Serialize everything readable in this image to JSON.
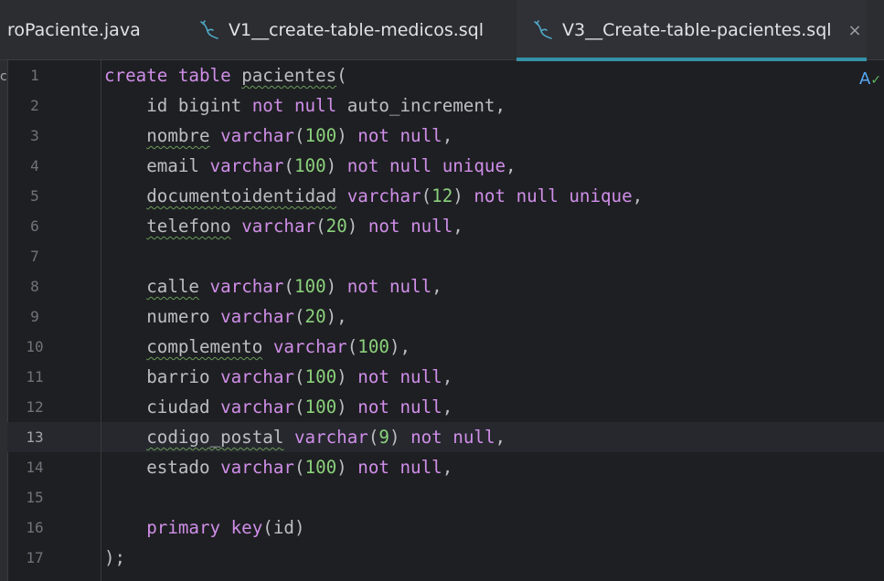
{
  "tabs": [
    {
      "label": "roPaciente.java",
      "icon": "none",
      "active": false
    },
    {
      "label": "V1__create-table-medicos.sql",
      "icon": "sql-dolphin-icon",
      "active": false
    },
    {
      "label": "V3__Create-table-pacientes.sql",
      "icon": "sql-dolphin-icon",
      "active": true,
      "close": "×"
    }
  ],
  "left_cut_text": "c",
  "inspection_widget": "A",
  "current_line": 13,
  "colors": {
    "background": "#1e1f22",
    "keyword": "#cf8ee8",
    "number": "#8bd17c",
    "plain": "#bcbec4",
    "active_tab_underline": "#3592a8"
  },
  "lines": [
    {
      "n": "1",
      "tokens": [
        {
          "t": "kw",
          "v": "create"
        },
        {
          "t": "pl",
          "v": " "
        },
        {
          "t": "kw",
          "v": "table"
        },
        {
          "t": "pl",
          "v": " "
        },
        {
          "t": "sq",
          "v": "pacientes"
        },
        {
          "t": "pl",
          "v": "("
        }
      ]
    },
    {
      "n": "2",
      "tokens": [
        {
          "t": "pl",
          "v": "    id "
        },
        {
          "t": "pl",
          "v": "bigint"
        },
        {
          "t": "pl",
          "v": " "
        },
        {
          "t": "kw",
          "v": "not null"
        },
        {
          "t": "pl",
          "v": " auto_increment,"
        }
      ]
    },
    {
      "n": "3",
      "tokens": [
        {
          "t": "pl",
          "v": "    "
        },
        {
          "t": "sq",
          "v": "nombre"
        },
        {
          "t": "pl",
          "v": " "
        },
        {
          "t": "ty",
          "v": "varchar"
        },
        {
          "t": "pl",
          "v": "("
        },
        {
          "t": "num",
          "v": "100"
        },
        {
          "t": "pl",
          "v": ") "
        },
        {
          "t": "kw",
          "v": "not null"
        },
        {
          "t": "pl",
          "v": ","
        }
      ]
    },
    {
      "n": "4",
      "tokens": [
        {
          "t": "pl",
          "v": "    email "
        },
        {
          "t": "ty",
          "v": "varchar"
        },
        {
          "t": "pl",
          "v": "("
        },
        {
          "t": "num",
          "v": "100"
        },
        {
          "t": "pl",
          "v": ") "
        },
        {
          "t": "kw",
          "v": "not null unique"
        },
        {
          "t": "pl",
          "v": ","
        }
      ]
    },
    {
      "n": "5",
      "tokens": [
        {
          "t": "pl",
          "v": "    "
        },
        {
          "t": "sq",
          "v": "documentoidentidad"
        },
        {
          "t": "pl",
          "v": " "
        },
        {
          "t": "ty",
          "v": "varchar"
        },
        {
          "t": "pl",
          "v": "("
        },
        {
          "t": "num",
          "v": "12"
        },
        {
          "t": "pl",
          "v": ") "
        },
        {
          "t": "kw",
          "v": "not null unique"
        },
        {
          "t": "pl",
          "v": ","
        }
      ]
    },
    {
      "n": "6",
      "tokens": [
        {
          "t": "pl",
          "v": "    "
        },
        {
          "t": "sq",
          "v": "telefono"
        },
        {
          "t": "pl",
          "v": " "
        },
        {
          "t": "ty",
          "v": "varchar"
        },
        {
          "t": "pl",
          "v": "("
        },
        {
          "t": "num",
          "v": "20"
        },
        {
          "t": "pl",
          "v": ") "
        },
        {
          "t": "kw",
          "v": "not null"
        },
        {
          "t": "pl",
          "v": ","
        }
      ]
    },
    {
      "n": "7",
      "tokens": []
    },
    {
      "n": "8",
      "tokens": [
        {
          "t": "pl",
          "v": "    "
        },
        {
          "t": "sq",
          "v": "calle"
        },
        {
          "t": "pl",
          "v": " "
        },
        {
          "t": "ty",
          "v": "varchar"
        },
        {
          "t": "pl",
          "v": "("
        },
        {
          "t": "num",
          "v": "100"
        },
        {
          "t": "pl",
          "v": ") "
        },
        {
          "t": "kw",
          "v": "not null"
        },
        {
          "t": "pl",
          "v": ","
        }
      ]
    },
    {
      "n": "9",
      "tokens": [
        {
          "t": "pl",
          "v": "    numero "
        },
        {
          "t": "ty",
          "v": "varchar"
        },
        {
          "t": "pl",
          "v": "("
        },
        {
          "t": "num",
          "v": "20"
        },
        {
          "t": "pl",
          "v": "),"
        }
      ]
    },
    {
      "n": "10",
      "tokens": [
        {
          "t": "pl",
          "v": "    "
        },
        {
          "t": "sq",
          "v": "complemento"
        },
        {
          "t": "pl",
          "v": " "
        },
        {
          "t": "ty",
          "v": "varchar"
        },
        {
          "t": "pl",
          "v": "("
        },
        {
          "t": "num",
          "v": "100"
        },
        {
          "t": "pl",
          "v": "),"
        }
      ]
    },
    {
      "n": "11",
      "tokens": [
        {
          "t": "pl",
          "v": "    barrio "
        },
        {
          "t": "ty",
          "v": "varchar"
        },
        {
          "t": "pl",
          "v": "("
        },
        {
          "t": "num",
          "v": "100"
        },
        {
          "t": "pl",
          "v": ") "
        },
        {
          "t": "kw",
          "v": "not null"
        },
        {
          "t": "pl",
          "v": ","
        }
      ]
    },
    {
      "n": "12",
      "tokens": [
        {
          "t": "pl",
          "v": "    ciudad "
        },
        {
          "t": "ty",
          "v": "varchar"
        },
        {
          "t": "pl",
          "v": "("
        },
        {
          "t": "num",
          "v": "100"
        },
        {
          "t": "pl",
          "v": ") "
        },
        {
          "t": "kw",
          "v": "not null"
        },
        {
          "t": "pl",
          "v": ","
        }
      ]
    },
    {
      "n": "13",
      "tokens": [
        {
          "t": "pl",
          "v": "    "
        },
        {
          "t": "sq",
          "v": "codigo_postal"
        },
        {
          "t": "pl",
          "v": " "
        },
        {
          "t": "ty",
          "v": "varchar"
        },
        {
          "t": "pl",
          "v": "("
        },
        {
          "t": "num",
          "v": "9"
        },
        {
          "t": "pl",
          "v": ") "
        },
        {
          "t": "kw",
          "v": "not null"
        },
        {
          "t": "pl",
          "v": ","
        }
      ]
    },
    {
      "n": "14",
      "tokens": [
        {
          "t": "pl",
          "v": "    estado "
        },
        {
          "t": "ty",
          "v": "varchar"
        },
        {
          "t": "pl",
          "v": "("
        },
        {
          "t": "num",
          "v": "100"
        },
        {
          "t": "pl",
          "v": ") "
        },
        {
          "t": "kw",
          "v": "not null"
        },
        {
          "t": "pl",
          "v": ","
        }
      ]
    },
    {
      "n": "15",
      "tokens": []
    },
    {
      "n": "16",
      "tokens": [
        {
          "t": "pl",
          "v": "    "
        },
        {
          "t": "kw",
          "v": "primary key"
        },
        {
          "t": "pl",
          "v": "(id)"
        }
      ]
    },
    {
      "n": "17",
      "tokens": [
        {
          "t": "pl",
          "v": ");"
        }
      ]
    }
  ]
}
